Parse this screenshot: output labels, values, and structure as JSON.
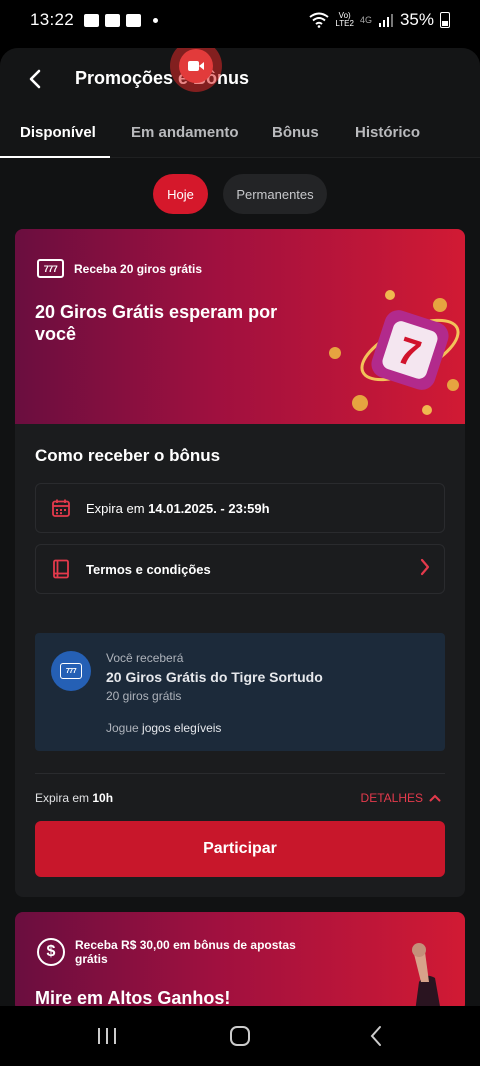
{
  "status_bar": {
    "time": "13:22",
    "network_top": "Vo)",
    "network_bottom": "LTE2",
    "signal_type": "4G",
    "battery": "35%"
  },
  "header": {
    "title": "Promoções e Bônus",
    "back_icon": "back-arrow-icon",
    "overlay_icon": "screen-record-icon"
  },
  "tabs": [
    {
      "label": "Disponível",
      "active": true
    },
    {
      "label": "Em andamento",
      "active": false
    },
    {
      "label": "Bônus",
      "active": false
    },
    {
      "label": "Histórico",
      "active": false
    }
  ],
  "filters": {
    "today": "Hoje",
    "permanent": "Permanentes"
  },
  "promo1": {
    "icon_text": "777",
    "tagline": "Receba 20 giros grátis",
    "headline": "20 Giros Grátis esperam por você",
    "how_title": "Como receber o bônus",
    "expiry_prefix": "Expira em ",
    "expiry_value": "14.01.2025. - 23:59h",
    "terms": "Termos e condições",
    "reward_label": "Você receberá",
    "reward_title": "20 Giros Grátis do Tigre Sortudo",
    "reward_sub": "20 giros grátis",
    "play_prefix": "Jogue ",
    "play_link": "jogos elegíveis",
    "expires_in_prefix": "Expira em ",
    "expires_in_value": "10h",
    "details": "DETALHES",
    "cta": "Participar"
  },
  "promo2": {
    "icon_text": "$",
    "tagline": "Receba R$ 30,00 em bônus de apostas grátis",
    "headline": "Mire em Altos Ganhos!"
  },
  "colors": {
    "accent": "#d5182b",
    "info_bg": "#1c2a3a",
    "card_bg": "#1b1c1e"
  }
}
